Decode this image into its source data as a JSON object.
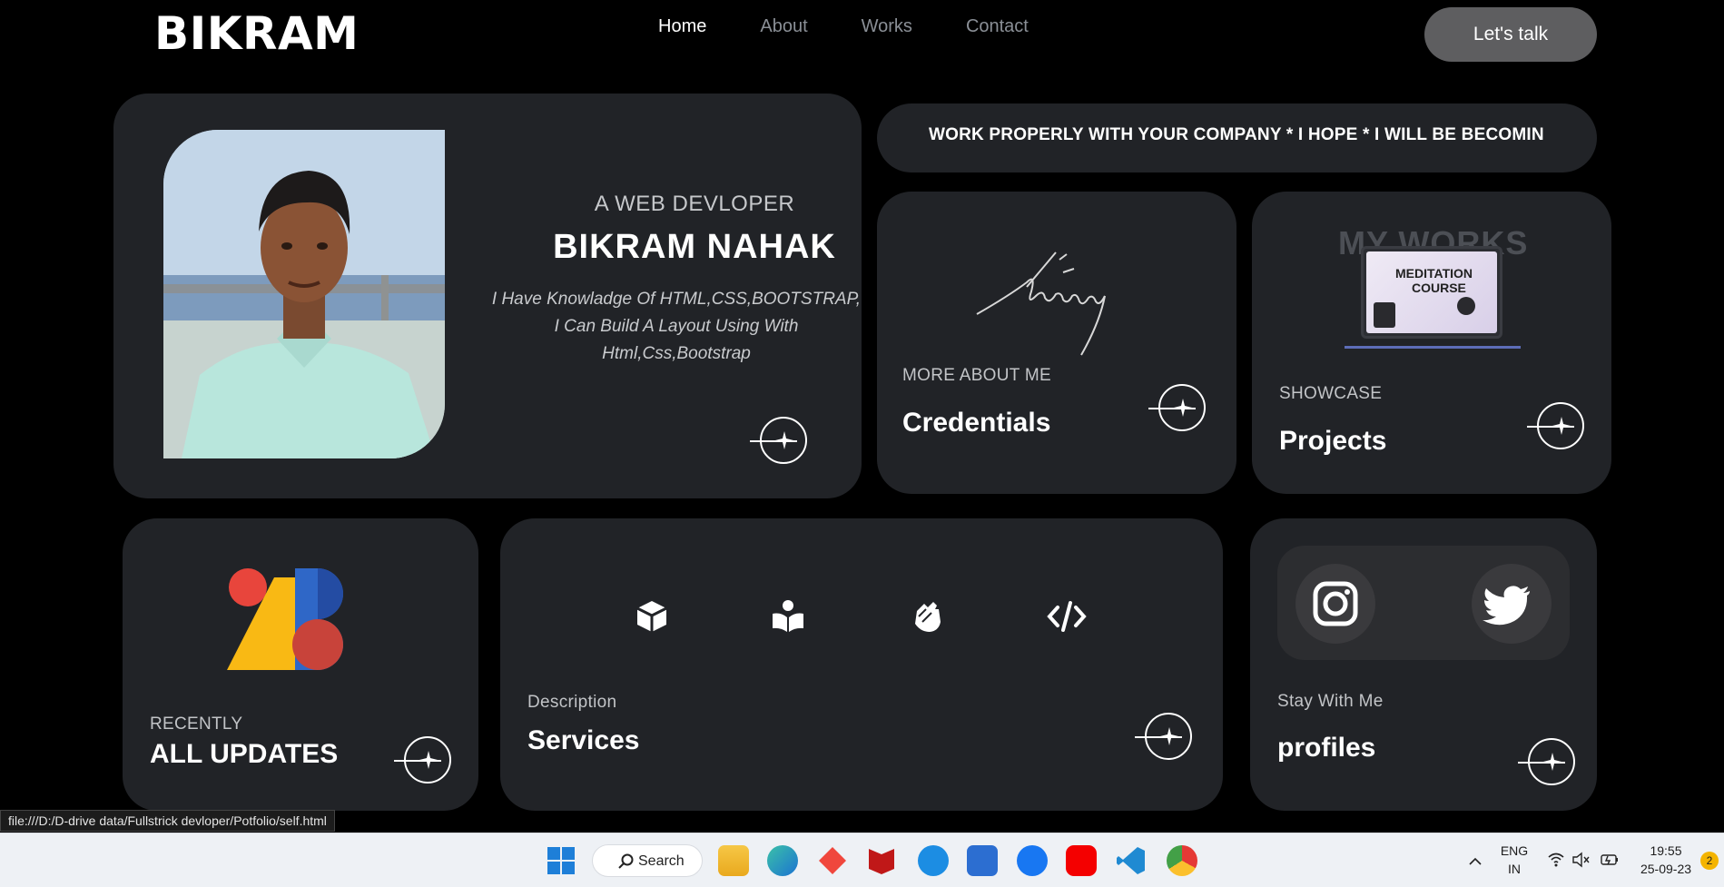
{
  "header": {
    "logo": "BIKRAM",
    "nav": [
      "Home",
      "About",
      "Works",
      "Contact"
    ],
    "cta": "Let's talk"
  },
  "profile": {
    "subtitle": "A WEB DEVLOPER",
    "name": "BIKRAM NAHAK",
    "bio": "I Have Knowladge Of HTML,CSS,BOOTSTRAP, I Can Build A Layout Using With Html,Css,Bootstrap"
  },
  "marquee": {
    "text": "WORK PROPERLY WITH YOUR COMPANY * I HOPE * I WILL BE BECOMING A PART OF YOUR COMPANY"
  },
  "credentials": {
    "label": "MORE ABOUT ME",
    "title": "Credentials"
  },
  "projects": {
    "label": "SHOWCASE",
    "title": "Projects",
    "banner": "MY WORKS",
    "screen_heading_1": "MEDITATION",
    "screen_heading_2": "COURSE"
  },
  "updates": {
    "label": "RECENTLY",
    "title": "ALL UPDATES"
  },
  "services": {
    "label": "Description",
    "title": "Services",
    "icons": [
      "cube-icon",
      "book-reader-icon",
      "hands-clapping-icon",
      "code-icon"
    ]
  },
  "profiles": {
    "label": "Stay With Me",
    "title": "profiles",
    "icons": [
      "instagram-icon",
      "twitter-icon"
    ]
  },
  "status_url": "file:///D:/D-drive data/Fullstrick devloper/Potfolio/self.html",
  "taskbar": {
    "search": "Search",
    "lang_1": "ENG",
    "lang_2": "IN",
    "time": "19:55",
    "date": "25-09-23",
    "notif_count": "2"
  },
  "colors": {
    "background": "#000000",
    "card": "#212327",
    "button": "#5e5e60",
    "text_muted": "#8a8f96"
  }
}
